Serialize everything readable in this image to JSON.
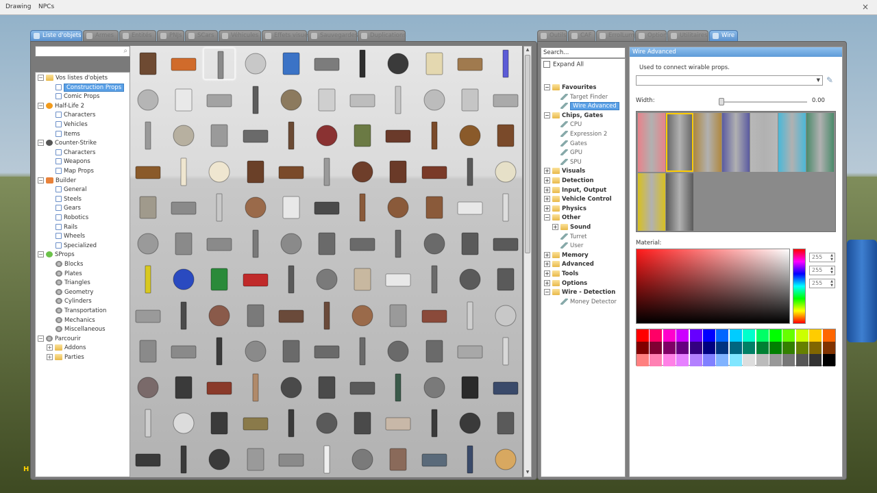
{
  "menubar": {
    "items": [
      "Drawing",
      "NPCs"
    ],
    "close": "×"
  },
  "hud": {
    "left_text": "H"
  },
  "spawnmenu": {
    "tabs": [
      {
        "label": "Liste d'objets",
        "active": true
      },
      {
        "label": "Armes"
      },
      {
        "label": "Entités"
      },
      {
        "label": "PNJs"
      },
      {
        "label": "SCars"
      },
      {
        "label": "Véhicules"
      },
      {
        "label": "Effets visuels"
      },
      {
        "label": "Sauvegardes"
      },
      {
        "label": "Duplications"
      }
    ],
    "search_placeholder": "",
    "tree": [
      {
        "label": "Vos listes d'objets",
        "icon": "folder",
        "depth": 0,
        "exp": "−"
      },
      {
        "label": "Construction Props",
        "icon": "page",
        "depth": 1,
        "selected": true
      },
      {
        "label": "Comic Props",
        "icon": "page",
        "depth": 1
      },
      {
        "label": "Half-Life 2",
        "icon": "hl2",
        "depth": 0,
        "exp": "−"
      },
      {
        "label": "Characters",
        "icon": "page",
        "depth": 1
      },
      {
        "label": "Vehicles",
        "icon": "page",
        "depth": 1
      },
      {
        "label": "Items",
        "icon": "page",
        "depth": 1
      },
      {
        "label": "Counter-Strike",
        "icon": "cs",
        "depth": 0,
        "exp": "−"
      },
      {
        "label": "Characters",
        "icon": "page",
        "depth": 1
      },
      {
        "label": "Weapons",
        "icon": "page",
        "depth": 1
      },
      {
        "label": "Map Props",
        "icon": "page",
        "depth": 1
      },
      {
        "label": "Builder",
        "icon": "builder",
        "depth": 0,
        "exp": "−"
      },
      {
        "label": "General",
        "icon": "page",
        "depth": 1
      },
      {
        "label": "Steels",
        "icon": "page",
        "depth": 1
      },
      {
        "label": "Gears",
        "icon": "page",
        "depth": 1
      },
      {
        "label": "Robotics",
        "icon": "page",
        "depth": 1
      },
      {
        "label": "Rails",
        "icon": "page",
        "depth": 1
      },
      {
        "label": "Wheels",
        "icon": "page",
        "depth": 1
      },
      {
        "label": "Specialized",
        "icon": "page",
        "depth": 1
      },
      {
        "label": "SProps",
        "icon": "sprops",
        "depth": 0,
        "exp": "−"
      },
      {
        "label": "Blocks",
        "icon": "gear",
        "depth": 1
      },
      {
        "label": "Plates",
        "icon": "gear",
        "depth": 1
      },
      {
        "label": "Triangles",
        "icon": "gear",
        "depth": 1
      },
      {
        "label": "Geometry",
        "icon": "gear",
        "depth": 1
      },
      {
        "label": "Cylinders",
        "icon": "gear",
        "depth": 1
      },
      {
        "label": "Transportation",
        "icon": "gear",
        "depth": 1
      },
      {
        "label": "Mechanics",
        "icon": "gear",
        "depth": 1
      },
      {
        "label": "Miscellaneous",
        "icon": "gear",
        "depth": 1
      },
      {
        "label": "Parcourir",
        "icon": "gear",
        "depth": 0,
        "exp": "−"
      },
      {
        "label": "Addons",
        "icon": "folder",
        "depth": 1,
        "exp": "+"
      },
      {
        "label": "Parties",
        "icon": "folder",
        "depth": 1,
        "exp": "+"
      }
    ],
    "prop_colors": [
      "#6e4a32",
      "#d06b2b",
      "#8a8a8a",
      "#c8c8c8",
      "#3b73c6",
      "#7c7c7c",
      "#2e2e2e",
      "#3a3a3a",
      "#e4d8b0",
      "#a07a4e",
      "#5b5bd6",
      "#b5b5b5",
      "#e9e9e9",
      "#a3a3a3",
      "#5c5c5c",
      "#8c7a5e",
      "#cfcfcf",
      "#bdbdbd",
      "#c8c8c8",
      "#bcbcbc",
      "#c5c5c5",
      "#aaaaaa",
      "#9a9a9a",
      "#b7b0a0",
      "#9a9a9a",
      "#6a6a6a",
      "#6b4a34",
      "#8a3232",
      "#6b7a44",
      "#6a3a2a",
      "#7a4a2a",
      "#8a5a2a",
      "#7a4a2a",
      "#8a5a2a",
      "#efe6d0",
      "#efe6d0",
      "#6a4028",
      "#7a4a2a",
      "#9a9a9a",
      "#6e3e2a",
      "#6a3a28",
      "#7a3a28",
      "#5a5a5a",
      "#e6e0c8",
      "#a09a8c",
      "#8a8a8a",
      "#c8c8c8",
      "#9a6a4a",
      "#e8e8e8",
      "#4a4a4a",
      "#8a5a3a",
      "#8a5a3a",
      "#8a5a3a",
      "#e8e8e8",
      "#dddddd",
      "#9a9a9a",
      "#8a8a8a",
      "#8a8a8a",
      "#7a7a7a",
      "#8a8a8a",
      "#6a6a6a",
      "#6a6a6a",
      "#6a6a6a",
      "#6a6a6a",
      "#5a5a5a",
      "#5a5a5a",
      "#d8c820",
      "#2a4ac0",
      "#2a8a3a",
      "#c02a2a",
      "#5a5a5a",
      "#7a7a7a",
      "#c8b8a0",
      "#e8e8e8",
      "#6a6a6a",
      "#5a5a5a",
      "#5a5a5a",
      "#9a9a9a",
      "#4a4a4a",
      "#8a5a4a",
      "#7a7a7a",
      "#6a4a3a",
      "#6a4a3a",
      "#9a6a4a",
      "#9a9a9a",
      "#8a4a3a",
      "#cfcfcf",
      "#c8c8c8",
      "#8a8a8a",
      "#8a8a8a",
      "#3a3a3a",
      "#8a8a8a",
      "#6a6a6a",
      "#6a6a6a",
      "#6a6a6a",
      "#6a6a6a",
      "#6a6a6a",
      "#a8a8a8",
      "#d8d8d8",
      "#7a6a6a",
      "#3a3a3a",
      "#8a3a2a",
      "#b08a6a",
      "#4a4a4a",
      "#4a4a4a",
      "#5a5a5a",
      "#3a5a4a",
      "#7a7a7a",
      "#2a2a2a",
      "#3a4a6a",
      "#cfcfcf",
      "#dcdcdc",
      "#3a3a3a",
      "#8a7a4a",
      "#3a3a3a",
      "#5a5a5a",
      "#4a4a4a",
      "#c8b8a8",
      "#3a3a3a",
      "#3a3a3a",
      "#5a5a5a",
      "#3a3a3a",
      "#3a3a3a",
      "#3a3a3a",
      "#9a9a9a",
      "#8a8a8a",
      "#efefef",
      "#7a7a7a",
      "#8a6a5a",
      "#5a6a7a",
      "#3a4a6a",
      "#d8a860"
    ]
  },
  "toolmenu": {
    "tabs": [
      {
        "label": "Outils"
      },
      {
        "label": "CAF"
      },
      {
        "label": "ErrolLump"
      },
      {
        "label": "Options"
      },
      {
        "label": "Utilitaires"
      },
      {
        "label": "Wire",
        "active": true
      }
    ],
    "search_placeholder": "Search...",
    "expand_all": "Expand All",
    "tree": [
      {
        "label": "Favourites",
        "cat": true,
        "exp": "−",
        "depth": 0
      },
      {
        "label": "Target Finder",
        "depth": 1
      },
      {
        "label": "Wire Advanced",
        "depth": 1,
        "selected": true
      },
      {
        "label": "Chips, Gates",
        "cat": true,
        "exp": "−",
        "depth": 0
      },
      {
        "label": "CPU",
        "depth": 1
      },
      {
        "label": "Expression 2",
        "depth": 1
      },
      {
        "label": "Gates",
        "depth": 1
      },
      {
        "label": "GPU",
        "depth": 1
      },
      {
        "label": "SPU",
        "depth": 1
      },
      {
        "label": "Visuals",
        "cat": true,
        "exp": "+",
        "depth": 0
      },
      {
        "label": "Detection",
        "cat": true,
        "exp": "+",
        "depth": 0
      },
      {
        "label": "Input, Output",
        "cat": true,
        "exp": "+",
        "depth": 0
      },
      {
        "label": "Vehicle Control",
        "cat": true,
        "exp": "+",
        "depth": 0
      },
      {
        "label": "Physics",
        "cat": true,
        "exp": "+",
        "depth": 0
      },
      {
        "label": "Other",
        "cat": true,
        "exp": "−",
        "depth": 0
      },
      {
        "label": "Sound",
        "cat": true,
        "exp": "+",
        "depth": 1
      },
      {
        "label": "Turret",
        "depth": 1
      },
      {
        "label": "User",
        "depth": 1
      },
      {
        "label": "Memory",
        "cat": true,
        "exp": "+",
        "depth": 0
      },
      {
        "label": "Advanced",
        "cat": true,
        "exp": "+",
        "depth": 0
      },
      {
        "label": "Tools",
        "cat": true,
        "exp": "+",
        "depth": 0
      },
      {
        "label": "Options",
        "cat": true,
        "exp": "+",
        "depth": 0
      },
      {
        "label": "Wire - Detection",
        "cat": true,
        "exp": "−",
        "depth": 0
      },
      {
        "label": "Money Detector",
        "depth": 1
      }
    ],
    "control": {
      "header": "Wire Advanced",
      "description": "Used to connect wirable props.",
      "combo_value": "",
      "width_label": "Width:",
      "width_value": "0.00",
      "material_label": "Material:",
      "rgb": [
        "255",
        "255",
        "255"
      ],
      "materials": [
        "#e8828a",
        "#6a6a6a",
        "#b08840",
        "#5a5aa0",
        "#b8b8b8",
        "#4ab8d8",
        "#4a8a6a",
        "#d8c020",
        "#5a5a5a"
      ],
      "palette": [
        "#ff0000",
        "#ff0066",
        "#ff00cc",
        "#cc00ff",
        "#6600ff",
        "#0000ff",
        "#0066ff",
        "#00ccff",
        "#00ffcc",
        "#00ff66",
        "#00ff00",
        "#66ff00",
        "#ccff00",
        "#ffcc00",
        "#ff6600",
        "#800000",
        "#800033",
        "#800066",
        "#660080",
        "#330080",
        "#000080",
        "#003380",
        "#006680",
        "#008066",
        "#008033",
        "#008000",
        "#338000",
        "#668000",
        "#806600",
        "#803300",
        "#ff8080",
        "#ff80b3",
        "#ff80e6",
        "#e680ff",
        "#b380ff",
        "#8080ff",
        "#80b3ff",
        "#80e6ff",
        "#dddddd",
        "#bbbbbb",
        "#999999",
        "#777777",
        "#555555",
        "#333333",
        "#000000"
      ]
    }
  }
}
